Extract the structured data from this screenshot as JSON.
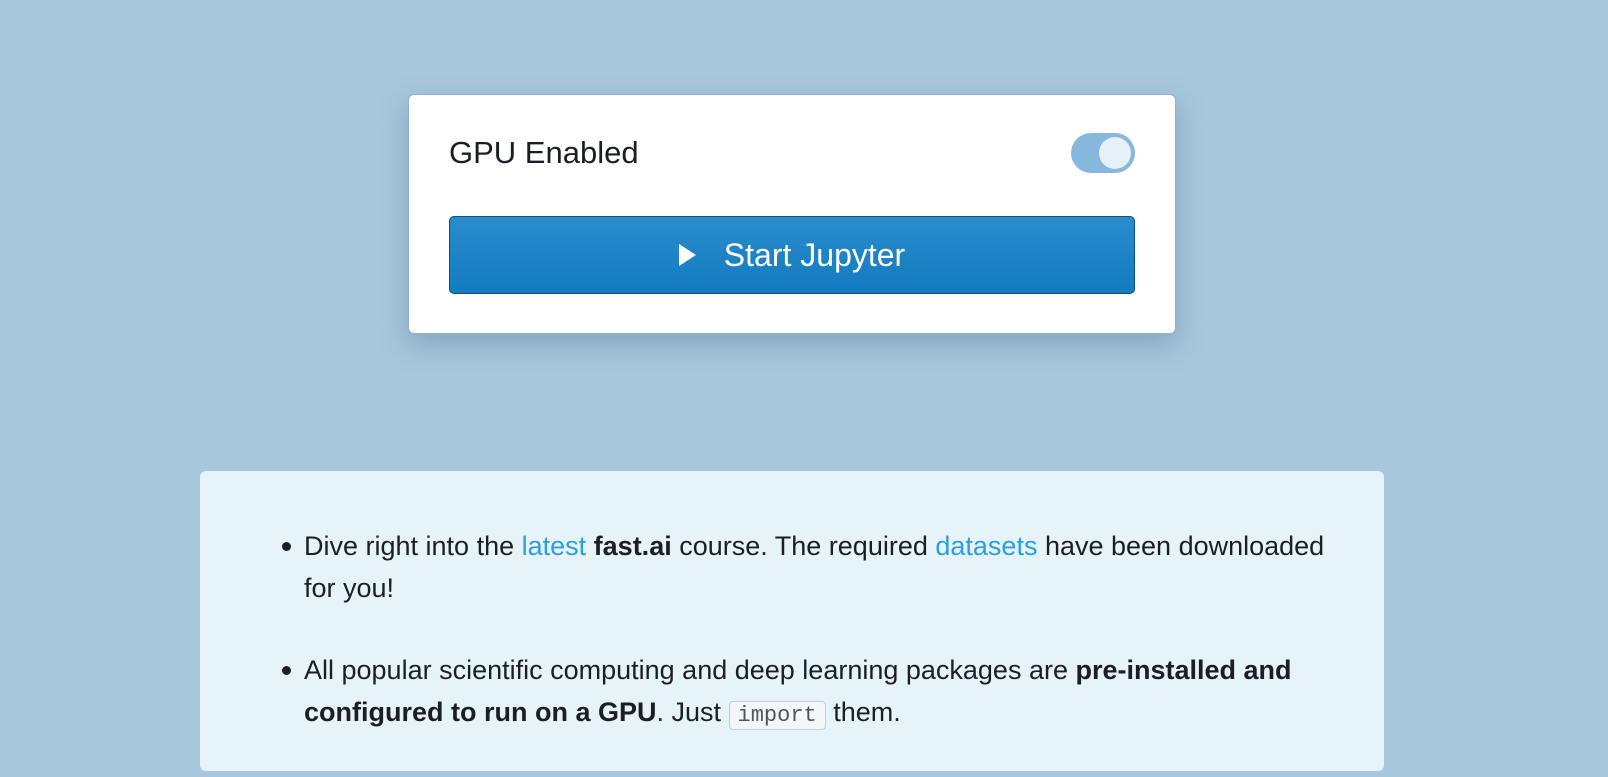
{
  "card": {
    "gpu_label": "GPU Enabled",
    "gpu_enabled": true,
    "start_button_label": "Start Jupyter"
  },
  "info": {
    "item1": {
      "t1": "Dive right into the ",
      "link_latest": "latest",
      "t2": " ",
      "bold_fastai": "fast.ai",
      "t3": " course. The required ",
      "link_datasets": "datasets",
      "t4": " have been downloaded for you!"
    },
    "item2": {
      "t1": "All popular scientific computing and deep learning packages are ",
      "bold": "pre-installed and configured to run on a GPU",
      "t2": ". Just ",
      "code": "import",
      "t3": " them."
    }
  },
  "colors": {
    "background": "#a7c7dc",
    "accent_button": "#1a82c5",
    "link": "#2a9fe0",
    "toggle_on": "#86b8de",
    "panel": "#e6f4fa"
  },
  "icons": {
    "start": "play-icon"
  }
}
